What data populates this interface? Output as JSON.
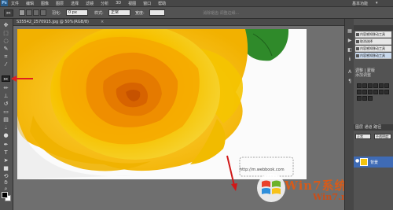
{
  "app": {
    "logo": "Ps",
    "workspace": "基本功能",
    "arrange": "▾"
  },
  "menubar": {
    "items": [
      "文件",
      "编辑",
      "图像",
      "图层",
      "选择",
      "滤镜",
      "分析",
      "3D",
      "视图",
      "窗口",
      "帮助"
    ]
  },
  "options": {
    "tool_icon": "✂",
    "feather_label": "羽化:",
    "feather_value": "0 px",
    "style_label": "样式:",
    "style_value": "正常",
    "width_label": "宽度:",
    "disabled_text": "消除锯齿  调整边缘..."
  },
  "document": {
    "tab_label": "S35542_2570915.jpg @ 50%(RGB/8)",
    "close": "×"
  },
  "canvas": {
    "url_text": "http://m.webbook.com"
  },
  "panels": {
    "history": [
      {
        "label": "内容感知移动工具"
      },
      {
        "label": "取消选择"
      },
      {
        "label": "内容感知移动工具"
      },
      {
        "label": "内容感知移动工具"
      }
    ],
    "adjustments_title": "调整 | 蒙版",
    "adjustments_subtitle": "添加调整",
    "layers_tab": "图层  通道  路径",
    "blend_mode": "正常",
    "opacity": "不透明度:",
    "layer_name": "背景"
  },
  "watermark": {
    "text": "Win7系统之家",
    "sub": "Win7.net"
  },
  "tool_icons": [
    "move-icon",
    "marquee-icon",
    "lasso-icon",
    "quick-select-icon",
    "crop-icon",
    "eyedropper-icon",
    "content-aware-move-icon",
    "brush-icon",
    "clone-stamp-icon",
    "history-brush-icon",
    "eraser-icon",
    "gradient-icon",
    "blur-icon",
    "dodge-icon",
    "pen-icon",
    "type-icon",
    "path-select-icon",
    "shape-icon",
    "3d-rotate-icon",
    "3d-orbit-icon",
    "hand-icon",
    "zoom-icon"
  ],
  "colors": {
    "accent": "#3f6bb5",
    "arrow": "#e02020",
    "rose": "#f5b800",
    "watermark": "#d65b1a"
  }
}
